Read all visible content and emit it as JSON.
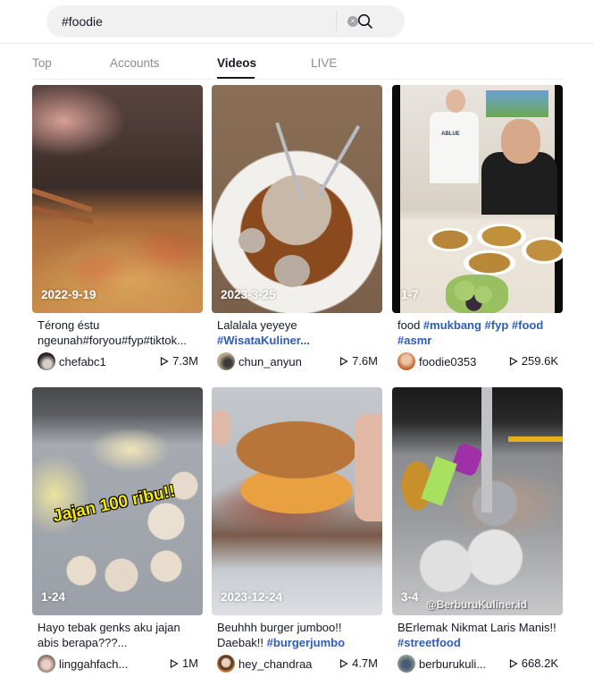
{
  "search": {
    "value": "#foodie",
    "clear_icon": "clear-x-icon",
    "search_icon": "search-icon"
  },
  "tabs": [
    {
      "label": "Top",
      "active": false
    },
    {
      "label": "Accounts",
      "active": false
    },
    {
      "label": "Videos",
      "active": true
    },
    {
      "label": "LIVE",
      "active": false
    }
  ],
  "colors": {
    "hashtag": "#2b5db9",
    "text": "#161823",
    "muted": "#8a8b91",
    "overlay_yellow": "#f7e900"
  },
  "videos": [
    {
      "date": "2022-9-19",
      "caption_text": "Térong éstu ngeunah#foryou#fyp#tiktok...",
      "caption_tags": "",
      "username": "chefabc1",
      "views": "7.3M"
    },
    {
      "date": "2023-3-25",
      "caption_text": "Lalalala yeyeye ",
      "caption_tags": "#WisataKuliner...",
      "username": "chun_anyun",
      "views": "7.6M"
    },
    {
      "date": "1-7",
      "caption_text": "food ",
      "caption_tags": "#mukbang #fyp #food #asmr",
      "username": "foodie0353",
      "views": "259.6K",
      "thumb_text": "ABLUE"
    },
    {
      "date": "1-24",
      "caption_text": "Hayo tebak genks aku jajan abis berapa???...",
      "caption_tags": "",
      "username": "linggahfach...",
      "views": "1M",
      "overlay": "Jajan 100 ribu!!"
    },
    {
      "date": "2023-12-24",
      "caption_text": "Beuhhh burger jumboo!! Daebak!! ",
      "caption_tags": "#burgerjumbo",
      "username": "hey_chandraa",
      "views": "4.7M"
    },
    {
      "date": "3-4",
      "caption_text": "BErlemak Nikmat Laris Manis!! ",
      "caption_tags": "#streetfood",
      "username": "berburukuli...",
      "views": "668.2K",
      "watermark": "@BerburuKuliner.id"
    }
  ]
}
